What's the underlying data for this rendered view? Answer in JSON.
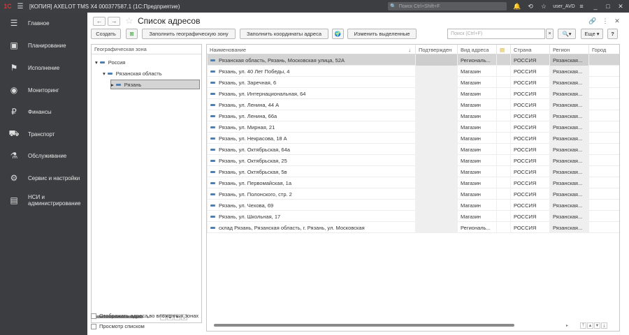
{
  "titlebar": {
    "logo": "1C",
    "title": "[КОПИЯ] AXELOT TMS X4 000377587.1  (1С:Предприятие)",
    "search_placeholder": "Поиск Ctrl+Shift+F",
    "user": "user_AVD"
  },
  "sidebar": {
    "items": [
      {
        "label": "Главное",
        "icon": "menu-icon"
      },
      {
        "label": "Планирование",
        "icon": "calendar-icon"
      },
      {
        "label": "Исполнение",
        "icon": "flag-icon"
      },
      {
        "label": "Мониторинг",
        "icon": "monitoring-icon"
      },
      {
        "label": "Финансы",
        "icon": "ruble-icon"
      },
      {
        "label": "Транспорт",
        "icon": "truck-icon"
      },
      {
        "label": "Обслуживание",
        "icon": "maintenance-icon"
      },
      {
        "label": "Сервис и настройки",
        "icon": "gear-icon"
      },
      {
        "label": "НСИ и\nадминистрирование",
        "icon": "admin-icon"
      }
    ]
  },
  "page": {
    "title": "Список адресов"
  },
  "toolbar": {
    "create": "Создать",
    "fill_zone": "Заполнить географическую зону",
    "fill_coords": "Заполнить координаты адреса",
    "edit_selected": "Изменить выделенные",
    "search_placeholder": "Поиск (Ctrl+F)",
    "more": "Еще",
    "help": "?"
  },
  "tree": {
    "header": "Географическая зона",
    "nodes": [
      {
        "label": "Россия",
        "level": 0
      },
      {
        "label": "Рязанская область",
        "level": 1
      },
      {
        "label": "Рязань",
        "level": 2,
        "selected": true
      }
    ],
    "show_nested": "Отображать адреса во вложенных зонах",
    "list_view": "Просмотр списком"
  },
  "grid": {
    "columns": [
      "Наименование",
      "Подтвержден",
      "Вид адреса",
      "",
      "Страна",
      "Регион",
      "Город"
    ],
    "rows": [
      {
        "name": "Рязанская область, Рязань, Московская улица, 52А",
        "type": "Региональ...",
        "country": "РОССИЯ",
        "region": "Рязанская..."
      },
      {
        "name": "Рязань, ул. 40 Лет Победы, 4",
        "type": "Магазин",
        "country": "РОССИЯ",
        "region": "Рязанская..."
      },
      {
        "name": "Рязань, ул. Заречная, 6",
        "type": "Магазин",
        "country": "РОССИЯ",
        "region": "Рязанская..."
      },
      {
        "name": "Рязань, ул. Интернациональная, 64",
        "type": "Магазин",
        "country": "РОССИЯ",
        "region": "Рязанская..."
      },
      {
        "name": "Рязань, ул. Ленина, 44 А",
        "type": "Магазин",
        "country": "РОССИЯ",
        "region": "Рязанская..."
      },
      {
        "name": "Рязань, ул. Ленина, 66а",
        "type": "Магазин",
        "country": "РОССИЯ",
        "region": "Рязанская..."
      },
      {
        "name": "Рязань, ул. Мирная, 21",
        "type": "Магазин",
        "country": "РОССИЯ",
        "region": "Рязанская..."
      },
      {
        "name": "Рязань, ул. Некрасова, 18 А",
        "type": "Магазин",
        "country": "РОССИЯ",
        "region": "Рязанская..."
      },
      {
        "name": "Рязань, ул. Октябрьская,  64а",
        "type": "Магазин",
        "country": "РОССИЯ",
        "region": "Рязанская..."
      },
      {
        "name": "Рязань, ул. Октябрьская, 25",
        "type": "Магазин",
        "country": "РОССИЯ",
        "region": "Рязанская..."
      },
      {
        "name": "Рязань, ул. Октябрьская, 5в",
        "type": "Магазин",
        "country": "РОССИЯ",
        "region": "Рязанская..."
      },
      {
        "name": "Рязань, ул. Первомайская, 1а",
        "type": "Магазин",
        "country": "РОССИЯ",
        "region": "Рязанская..."
      },
      {
        "name": "Рязань, ул. Полонского,  стр. 2",
        "type": "Магазин",
        "country": "РОССИЯ",
        "region": "Рязанская..."
      },
      {
        "name": "Рязань, ул. Чехова, 69",
        "type": "Магазин",
        "country": "РОССИЯ",
        "region": "Рязанская..."
      },
      {
        "name": "Рязань, ул. Школьная,   17",
        "type": "Магазин",
        "country": "РОССИЯ",
        "region": "Рязанская..."
      },
      {
        "name": "склад Рязань, Рязанская область, г. Рязань, ул. Московская",
        "type": "Региональ...",
        "country": "РОССИЯ",
        "region": "Рязанская..."
      }
    ]
  },
  "colors": {
    "sidebar": "#3b3d40",
    "titlebar": "#3c3e42",
    "selected_row": "#d4d4d4",
    "accent_dash": "#4d7fb2"
  }
}
